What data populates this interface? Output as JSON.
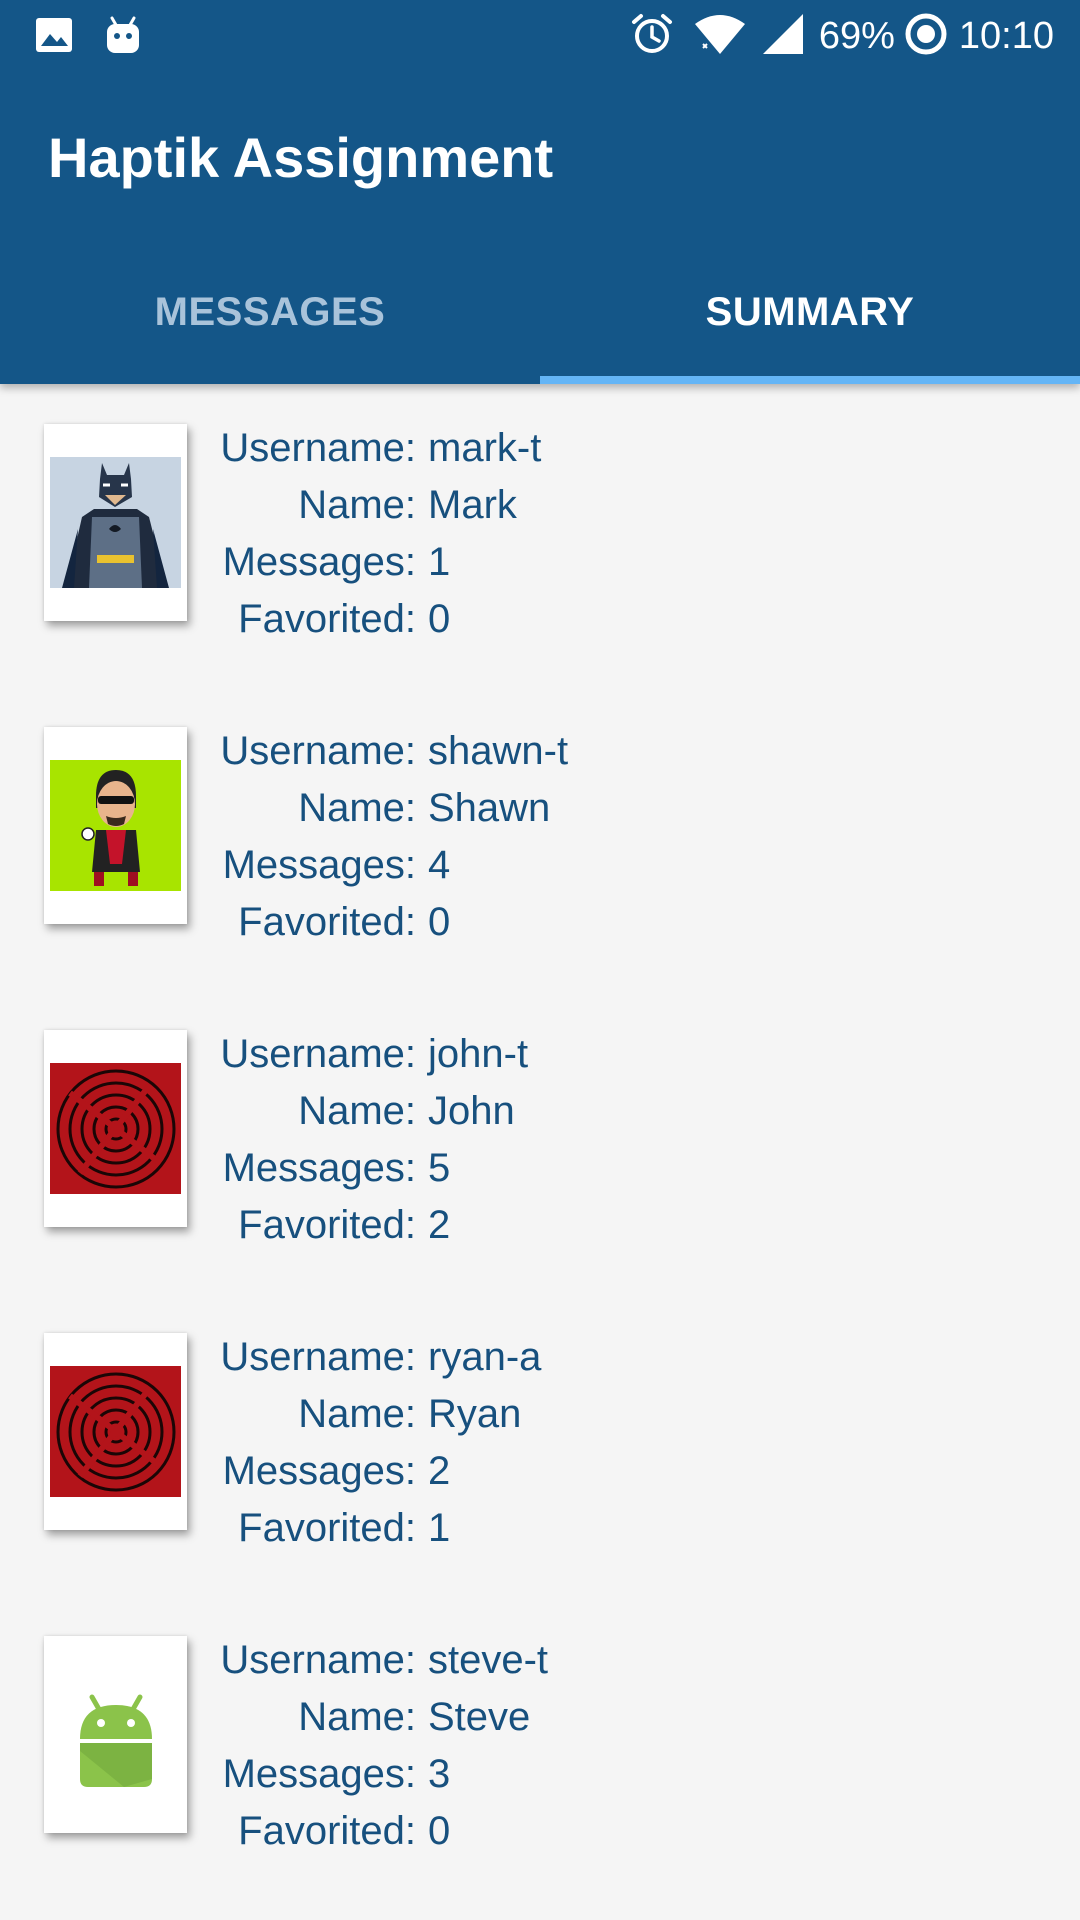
{
  "status_bar": {
    "battery": "69%",
    "time": "10:10",
    "icons": [
      "image-notification-icon",
      "android-notification-icon",
      "alarm-icon",
      "wifi-icon",
      "cell-signal-icon",
      "battery-saver-icon"
    ]
  },
  "app": {
    "title": "Haptik Assignment",
    "colors": {
      "primary": "#145688",
      "tab_indicator": "#64b5f6",
      "text": "#17507e",
      "background": "#f5f5f5"
    }
  },
  "tabs": [
    {
      "label": "MESSAGES",
      "active": false
    },
    {
      "label": "SUMMARY",
      "active": true
    }
  ],
  "labels": {
    "username": "Username:",
    "name": "Name:",
    "messages": "Messages:",
    "favorited": "Favorited:"
  },
  "users": [
    {
      "username": "mark-t",
      "name": "Mark",
      "messages": "1",
      "favorited": "0",
      "avatar": "batman-avatar"
    },
    {
      "username": "shawn-t",
      "name": "Shawn",
      "messages": "4",
      "favorited": "0",
      "avatar": "cartoon-avatar"
    },
    {
      "username": "john-t",
      "name": "John",
      "messages": "5",
      "favorited": "2",
      "avatar": "red-swirl-avatar"
    },
    {
      "username": "ryan-a",
      "name": "Ryan",
      "messages": "2",
      "favorited": "1",
      "avatar": "red-swirl-avatar"
    },
    {
      "username": "steve-t",
      "name": "Steve",
      "messages": "3",
      "favorited": "0",
      "avatar": "android-avatar"
    }
  ]
}
